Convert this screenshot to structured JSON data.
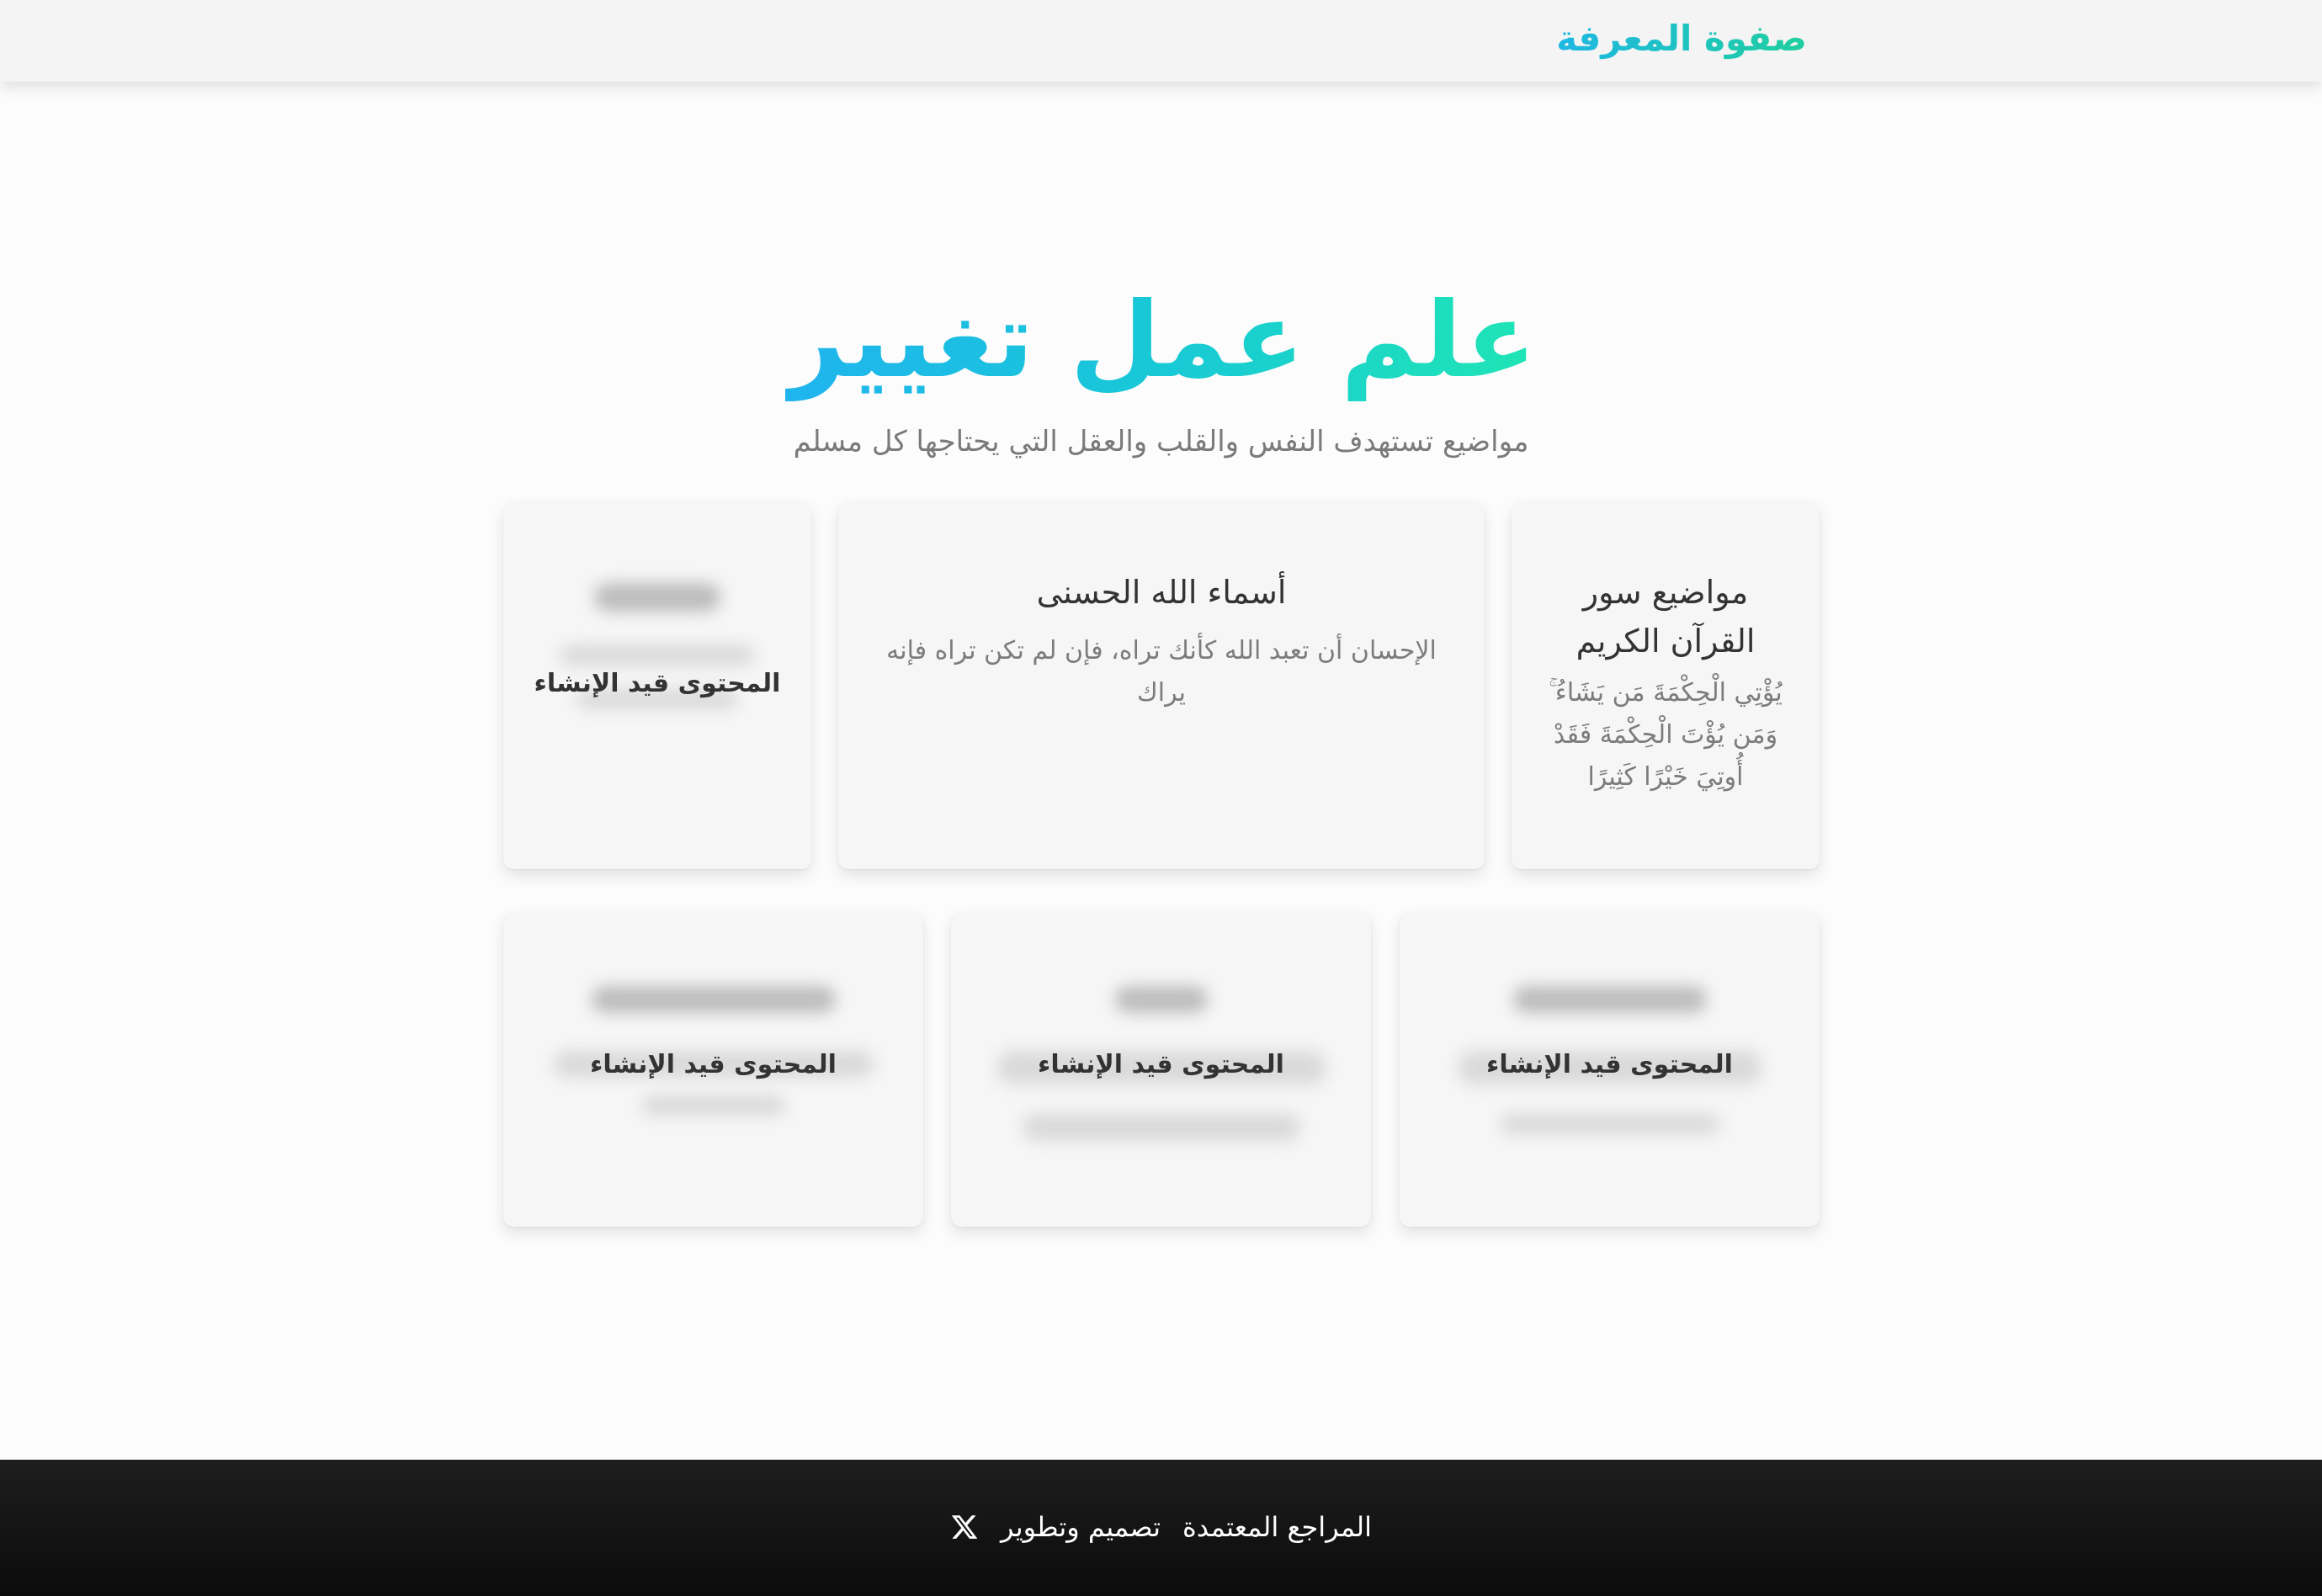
{
  "header": {
    "brand": "صفوة المعرفة"
  },
  "hero": {
    "title": "علم عمل تغيير",
    "subtitle": "مواضيع تستهدف النفس والقلب والعقل التي يحتاجها كل مسلم"
  },
  "cards": [
    {
      "title": "مواضيع سور القرآن الكريم",
      "text": "يُؤْتِي الْحِكْمَةَ مَن يَشَاءُ ۚ وَمَن يُؤْتَ الْحِكْمَةَ فَقَدْ أُوتِيَ خَيْرًا كَثِيرًا"
    },
    {
      "title": "أسماء الله الحسنى",
      "text": "الإحسان أن تعبد الله كأنك تراه، فإن لم تكن تراه فإنه يراك"
    },
    {
      "status": "المحتوى قيد الإنشاء"
    },
    {
      "status": "المحتوى قيد الإنشاء"
    },
    {
      "status": "المحتوى قيد الإنشاء"
    },
    {
      "status": "المحتوى قيد الإنشاء"
    }
  ],
  "footer": {
    "links": [
      "المراجع المعتمدة",
      "تصميم وتطوير"
    ],
    "social_icon": "x-logo-icon"
  },
  "colors": {
    "gradient_start": "#1eb7e4",
    "gradient_end": "#1fe5b5",
    "footer_bg": "#141414"
  }
}
